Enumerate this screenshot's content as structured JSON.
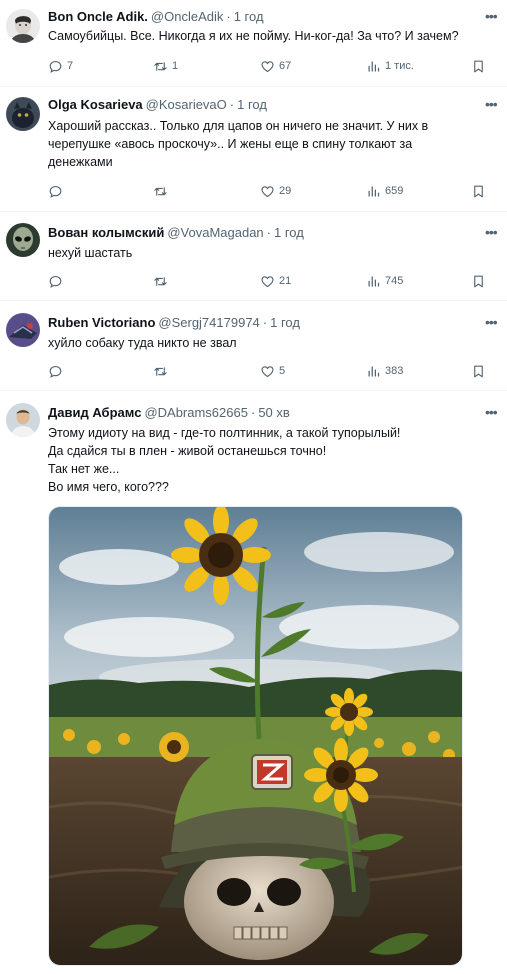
{
  "tweets": [
    {
      "name": "Bon Oncle Adik.",
      "handle": "@OncleAdik",
      "time": "1 год",
      "lines": [
        "Самоубийцы. Все. Никогда я их не пойму. Ни-ког-да! За что? И зачем?"
      ],
      "counts": {
        "reply": "7",
        "retweet": "1",
        "like": "67",
        "views": "1 тис."
      }
    },
    {
      "name": "Olga Kosarieva",
      "handle": "@KosarievaO",
      "time": "1 год",
      "lines": [
        "Хароший рассказ.. Только для цапов он ничего не значит. У них в",
        "черепушке «авось проскочу».. И жены еще в спину толкают за",
        "денежками"
      ],
      "counts": {
        "reply": "",
        "retweet": "",
        "like": "29",
        "views": "659"
      }
    },
    {
      "name": "Вован колымский",
      "handle": "@VovaMagadan",
      "time": "1 год",
      "lines": [
        "нехуй шастать"
      ],
      "counts": {
        "reply": "",
        "retweet": "",
        "like": "21",
        "views": "745"
      }
    },
    {
      "name": "Ruben Victoriano",
      "handle": "@Sergj74179974",
      "time": "1 год",
      "lines": [
        "хуйло собаку туда никто не звал"
      ],
      "counts": {
        "reply": "",
        "retweet": "",
        "like": "5",
        "views": "383"
      }
    },
    {
      "name": "Давид Абрамс",
      "handle": "@DAbrams62665",
      "time": "50 хв",
      "lines": [
        "Этому идиоту на вид - где-то полтинник, а такой тупорылый!",
        "Да сдайся ты в плен - живой останешься точно!",
        "Так нет же...",
        "Во имя чего, кого???"
      ],
      "counts": {}
    }
  ],
  "icons": {
    "reply": "reply-icon",
    "retweet": "retweet-icon",
    "like": "like-icon",
    "views": "views-icon",
    "bookmark": "bookmark-icon",
    "more": "more-icon"
  },
  "colors": {
    "text": "#0f1419",
    "secondary": "#536471",
    "separator": "#eff3f4"
  }
}
